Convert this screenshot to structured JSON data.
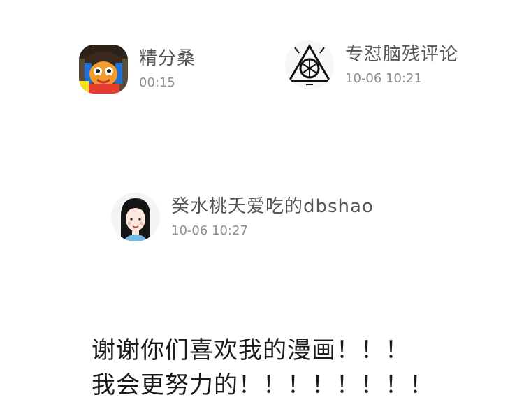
{
  "comments": [
    {
      "username": "精分桑",
      "time": "00:15",
      "avatar_icon": "cartoon-character-avatar"
    },
    {
      "username": "专怼脑残评论",
      "time": "10-06 10:21",
      "avatar_icon": "triangle-emblem-avatar"
    },
    {
      "username": "癸水桃夭爱吃的dbshao",
      "time": "10-06 10:27",
      "avatar_icon": "girl-portrait-avatar"
    }
  ],
  "message": {
    "line1": "谢谢你们喜欢我的漫画！！！",
    "line2": "我会更努力的！！！！！！！！"
  }
}
